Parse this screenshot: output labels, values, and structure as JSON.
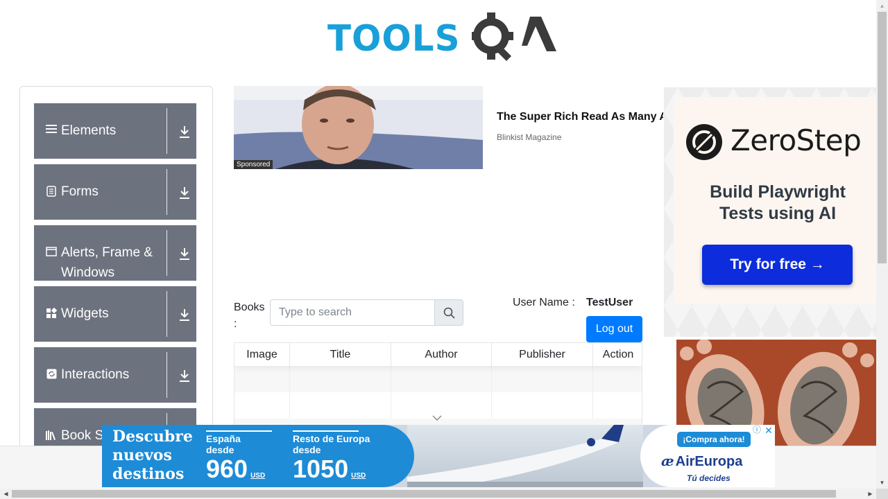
{
  "header": {
    "logo_text_blue": "TOOLS",
    "logo_text_dark": "QA"
  },
  "sidebar": {
    "groups": [
      {
        "label": "Elements",
        "icon": "hamburger-icon"
      },
      {
        "label": "Forms",
        "icon": "document-icon"
      },
      {
        "label": "Alerts, Frame & Windows",
        "icon": "window-icon"
      },
      {
        "label": "Widgets",
        "icon": "widgets-icon"
      },
      {
        "label": "Interactions",
        "icon": "refresh-icon"
      },
      {
        "label": "Book S",
        "icon": "books-icon"
      }
    ]
  },
  "top_ad": {
    "title": "The Super Rich Read As Many A",
    "source": "Blinkist Magazine",
    "sponsored": "Sponsored"
  },
  "books": {
    "label": "Books :",
    "search_placeholder": "Type to search",
    "user_label": "User Name :",
    "user_value": "TestUser",
    "logout_label": "Log out"
  },
  "table": {
    "columns": [
      "Image",
      "Title",
      "Author",
      "Publisher",
      "Action"
    ]
  },
  "right_ad": {
    "brand": "ZeroStep",
    "tagline": "Build Playwright Tests using AI",
    "cta": "Try for free →"
  },
  "bottom_ad": {
    "headline": "Descubre nuevos destinos",
    "offer1_label": "España desde",
    "offer1_price": "960",
    "offer2_label": "Resto de Europa desde",
    "offer2_price": "1050",
    "currency": "USD",
    "cta": "¡Compra ahora!",
    "brand": "AirEuropa",
    "slogan": "Tú decides"
  },
  "colors": {
    "sidebar_group": "#6c737f",
    "logo_blue": "#1aa0d8",
    "logout": "#007bff",
    "zerostep_cta": "#0d2cdc",
    "aireuropa_blue": "#1d8bd6"
  }
}
